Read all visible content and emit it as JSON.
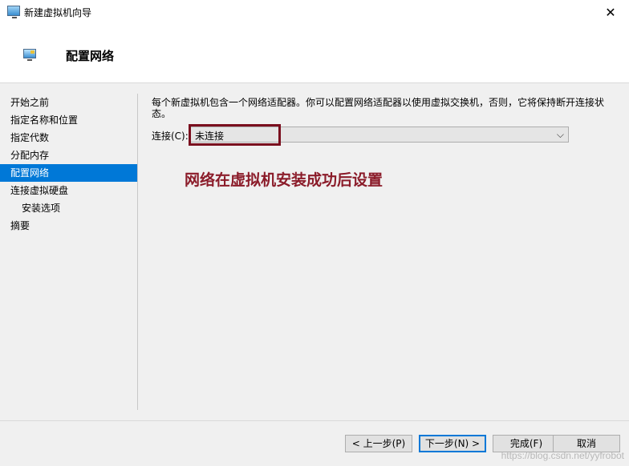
{
  "window": {
    "title": "新建虚拟机向导",
    "close_glyph": "✕"
  },
  "header": {
    "title": "配置网络"
  },
  "sidebar": {
    "items": [
      {
        "label": "开始之前"
      },
      {
        "label": "指定名称和位置"
      },
      {
        "label": "指定代数"
      },
      {
        "label": "分配内存"
      },
      {
        "label": "配置网络",
        "active": true
      },
      {
        "label": "连接虚拟硬盘"
      },
      {
        "label": "安装选项",
        "sub": true
      },
      {
        "label": "摘要"
      }
    ]
  },
  "main": {
    "description": "每个新虚拟机包含一个网络适配器。你可以配置网络适配器以使用虚拟交换机，否则，它将保持断开连接状态。",
    "connection_label": "连接(C):",
    "connection_value": "未连接",
    "annotation": "网络在虚拟机安装成功后设置",
    "annotation_color": "#8b1c2a",
    "highlight_color": "#7a0e1e"
  },
  "footer": {
    "prev_label": "< 上一步(P)",
    "next_label": "下一步(N) >",
    "finish_label": "完成(F)",
    "cancel_label": "取消"
  },
  "watermark": "https://blog.csdn.net/yyfrobot",
  "icons": {
    "title_icon": "virtual-machine-icon",
    "header_icon": "network-icon",
    "close": "close-icon",
    "dropdown": "chevron-down-icon"
  },
  "colors": {
    "active_item_bg": "#0078d7",
    "primary_button_border": "#0078d7"
  }
}
